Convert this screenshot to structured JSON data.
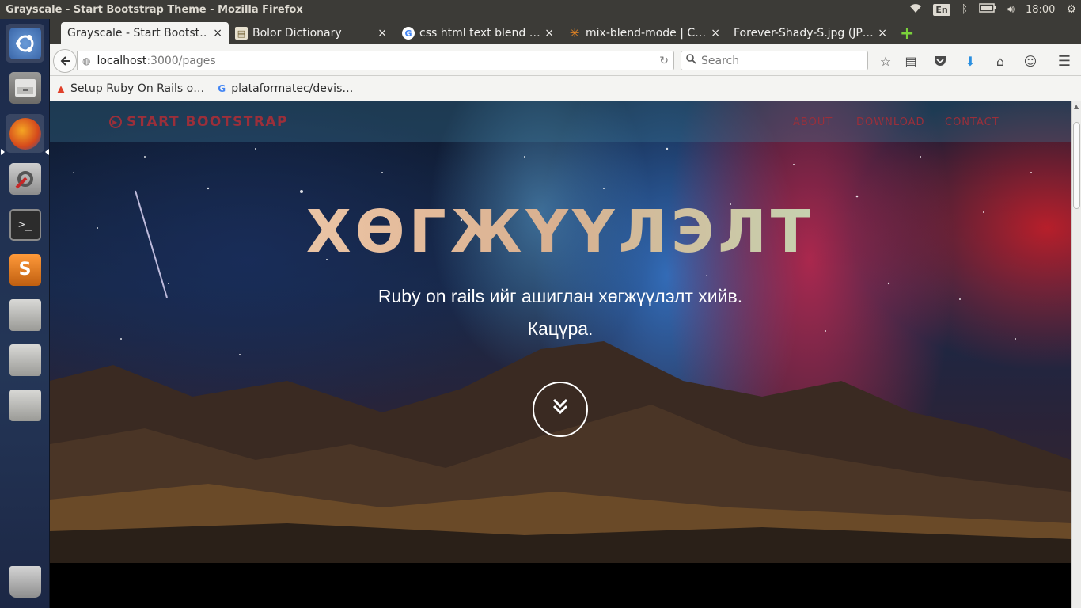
{
  "os": {
    "window_title": "Grayscale - Start Bootstrap Theme - Mozilla Firefox",
    "keyboard_layout": "En",
    "clock": "18:00"
  },
  "browser": {
    "tabs": [
      {
        "title": "Grayscale - Start Bootst…",
        "close": "×",
        "active": true
      },
      {
        "title": "Bolor Dictionary",
        "close": "×",
        "active": false
      },
      {
        "title": "css html text blend …",
        "close": "×",
        "active": false
      },
      {
        "title": "mix-blend-mode | C…",
        "close": "×",
        "active": false
      },
      {
        "title": "Forever-Shady-S.jpg (JP…",
        "close": "×",
        "active": false
      }
    ],
    "url_host": "localhost",
    "url_path": ":3000/pages",
    "search_placeholder": "Search",
    "bookmarks": [
      {
        "label": "Setup Ruby On Rails o…"
      },
      {
        "label": "plataformatec/devis…"
      }
    ]
  },
  "page": {
    "brand": "START BOOTSTRAP",
    "menu": [
      "ABOUT",
      "DOWNLOAD",
      "CONTACT"
    ],
    "headline": "ХӨГЖҮҮЛЭЛТ",
    "subline_1": "Ruby on rails ийг ашиглан хөгжүүлэлт хийв.",
    "subline_2": "Кацүра."
  },
  "colors": {
    "brand_red": "#9b2f3a",
    "panel_bg": "#3c3b37",
    "launcher_bg": "#1c2a4a"
  }
}
